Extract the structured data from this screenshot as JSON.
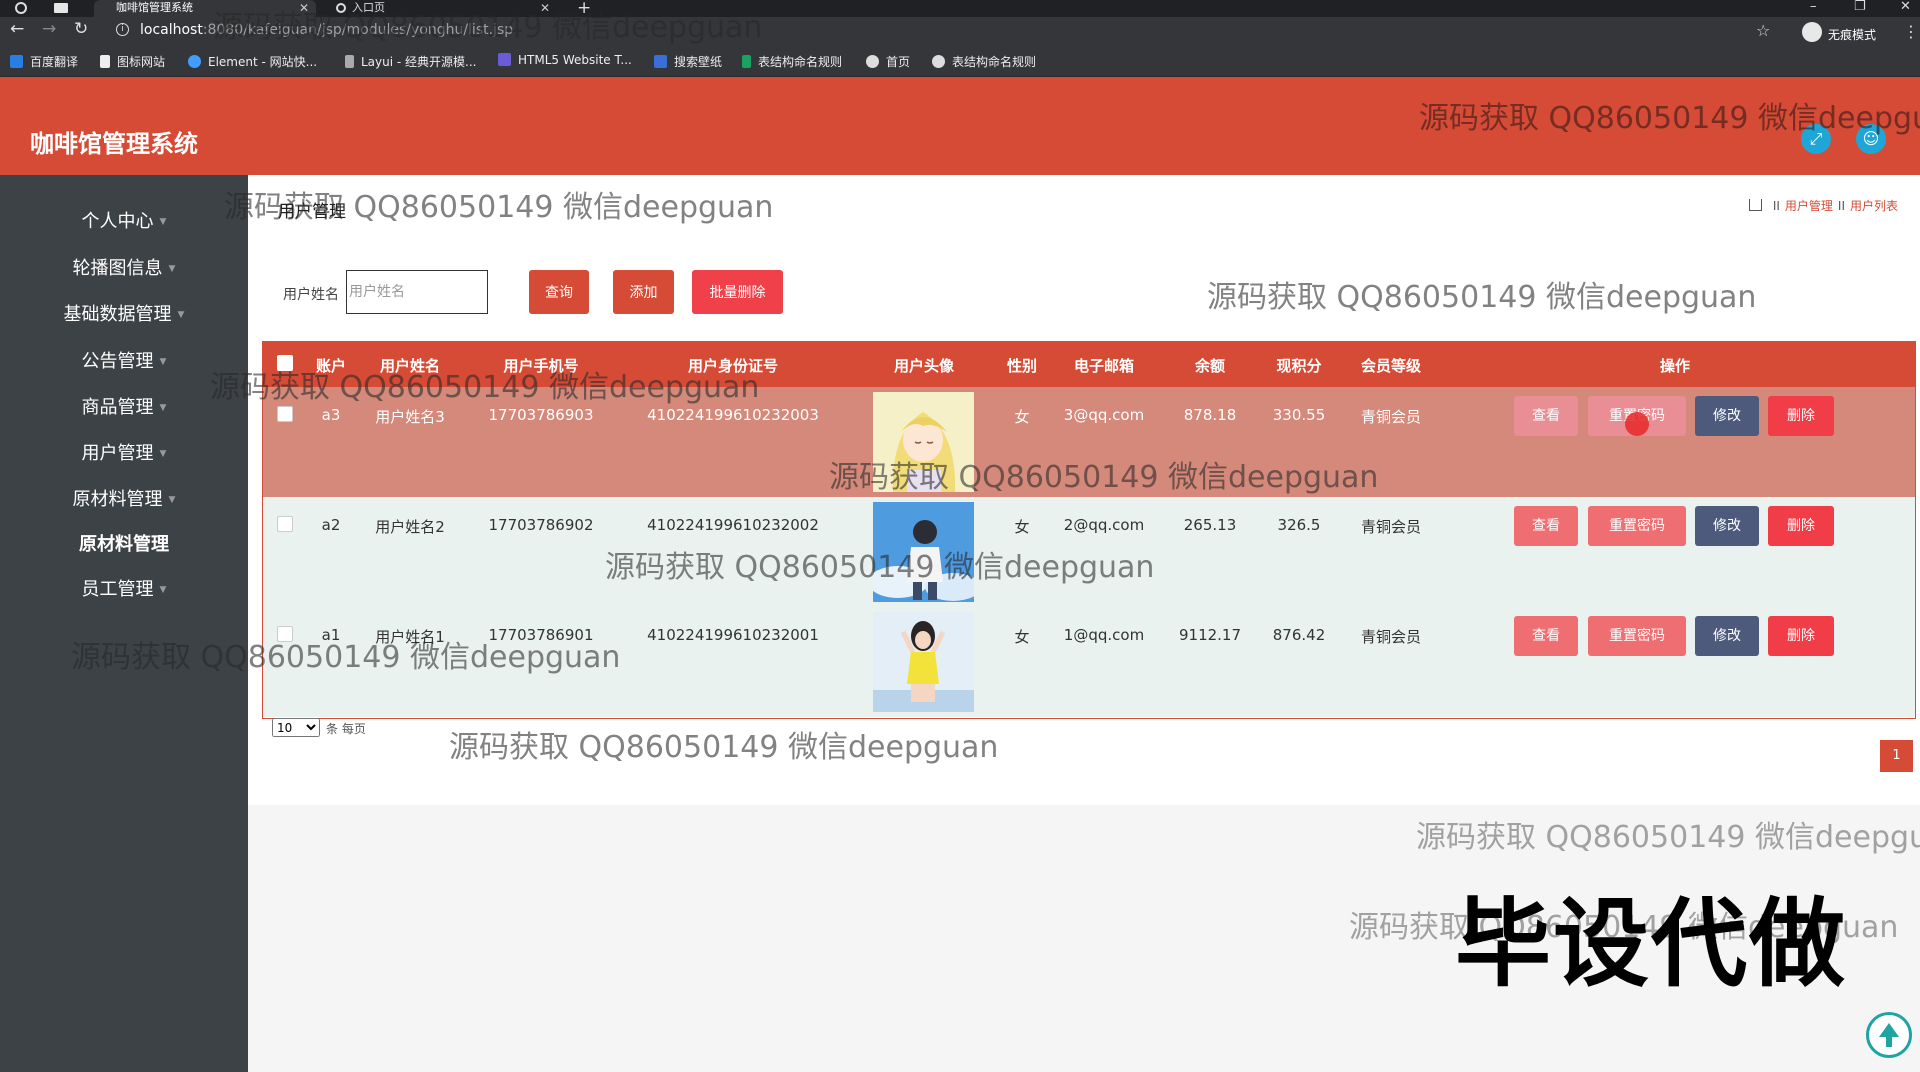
{
  "browser": {
    "tabs": [
      {
        "label": "咖啡馆管理系统",
        "active": true
      },
      {
        "label": "入口页",
        "active": false
      }
    ],
    "url_host": "localhost",
    "url_path": ":8080/kafeiguan/jsp/modules/yonghu/list.jsp",
    "profile_label": "无痕模式",
    "bookmarks": [
      "百度翻译",
      "图标网站",
      "Element - 网站快...",
      "Layui - 经典开源模...",
      "HTML5 Website T...",
      "搜索壁纸",
      "表结构命名规则",
      "首页",
      "表结构命名规则"
    ]
  },
  "app": {
    "title": "咖啡馆管理系统",
    "accent": "#d64b35"
  },
  "sidebar": {
    "items": [
      {
        "label": "个人中心"
      },
      {
        "label": "轮播图信息"
      },
      {
        "label": "基础数据管理"
      },
      {
        "label": "公告管理"
      },
      {
        "label": "商品管理"
      },
      {
        "label": "用户管理"
      },
      {
        "label": "原材料管理"
      },
      {
        "label": "原材料管理"
      },
      {
        "label": "员工管理"
      }
    ]
  },
  "page": {
    "heading": "用户管理",
    "breadcrumb": [
      "用户管理",
      "用户列表"
    ],
    "breadcrumb_sep": "II"
  },
  "search": {
    "label": "用户姓名",
    "placeholder": "用户姓名",
    "query_btn": "查询",
    "add_btn": "添加",
    "bulk_delete_btn": "批量删除"
  },
  "table": {
    "headers": {
      "account": "账户",
      "name": "用户姓名",
      "phone": "用户手机号",
      "idcard": "用户身份证号",
      "avatar": "用户头像",
      "gender": "性别",
      "email": "电子邮箱",
      "balance": "余额",
      "points": "现积分",
      "level": "会员等级",
      "actions": "操作"
    },
    "rows": [
      {
        "account": "a3",
        "name": "用户姓名3",
        "phone": "17703786903",
        "idcard": "410224199610232003",
        "gender": "女",
        "email": "3@qq.com",
        "balance": "878.18",
        "points": "330.55",
        "level": "青铜会员",
        "avatar_icon": "anime-girl-avatar"
      },
      {
        "account": "a2",
        "name": "用户姓名2",
        "phone": "17703786902",
        "idcard": "410224199610232002",
        "gender": "女",
        "email": "2@qq.com",
        "balance": "265.13",
        "points": "326.5",
        "level": "青铜会员",
        "avatar_icon": "boy-sky-avatar"
      },
      {
        "account": "a1",
        "name": "用户姓名1",
        "phone": "17703786901",
        "idcard": "410224199610232001",
        "gender": "女",
        "email": "1@qq.com",
        "balance": "9112.17",
        "points": "876.42",
        "level": "青铜会员",
        "avatar_icon": "girl-yellow-avatar"
      }
    ],
    "actions": {
      "view": "查看",
      "reset": "重置密码",
      "edit": "修改",
      "delete": "删除"
    }
  },
  "pager": {
    "page_size": "10",
    "per_page_label": "条 每页",
    "current_page": "1"
  },
  "overlay": {
    "watermark": "源码获取 QQ86050149 微信deepguan",
    "watermark_cut": "源码获取 QQ86050149 微信deepgu",
    "stamp": "毕设代做"
  }
}
